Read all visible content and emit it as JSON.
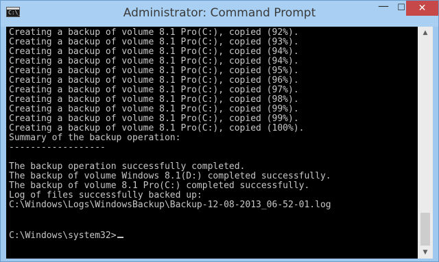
{
  "window": {
    "title": "Administrator: Command Prompt",
    "icon_glyph": "C:\\_",
    "controls": {
      "minimize": "—",
      "maximize": "☐",
      "close": "✕"
    }
  },
  "console": {
    "lines": [
      "Creating a backup of volume 8.1 Pro(C:), copied (92%).",
      "Creating a backup of volume 8.1 Pro(C:), copied (93%).",
      "Creating a backup of volume 8.1 Pro(C:), copied (94%).",
      "Creating a backup of volume 8.1 Pro(C:), copied (94%).",
      "Creating a backup of volume 8.1 Pro(C:), copied (95%).",
      "Creating a backup of volume 8.1 Pro(C:), copied (96%).",
      "Creating a backup of volume 8.1 Pro(C:), copied (97%).",
      "Creating a backup of volume 8.1 Pro(C:), copied (98%).",
      "Creating a backup of volume 8.1 Pro(C:), copied (99%).",
      "Creating a backup of volume 8.1 Pro(C:), copied (99%).",
      "Creating a backup of volume 8.1 Pro(C:), copied (100%).",
      "Summary of the backup operation:",
      "------------------",
      "",
      "The backup operation successfully completed.",
      "The backup of volume Windows 8.1(D:) completed successfully.",
      "The backup of volume 8.1 Pro(C:) completed successfully.",
      "Log of files successfully backed up:",
      "C:\\Windows\\Logs\\WindowsBackup\\Backup-12-08-2013_06-52-01.log",
      "",
      "",
      "",
      "C:\\Windows\\system32>"
    ]
  },
  "scrollbar": {
    "up_arrow": "▲",
    "down_arrow": "▼"
  },
  "colors": {
    "title_bar": "#a9d0f2",
    "console_background": "#000000",
    "console_text": "#c8c8c8",
    "close_button": "#c74848"
  }
}
